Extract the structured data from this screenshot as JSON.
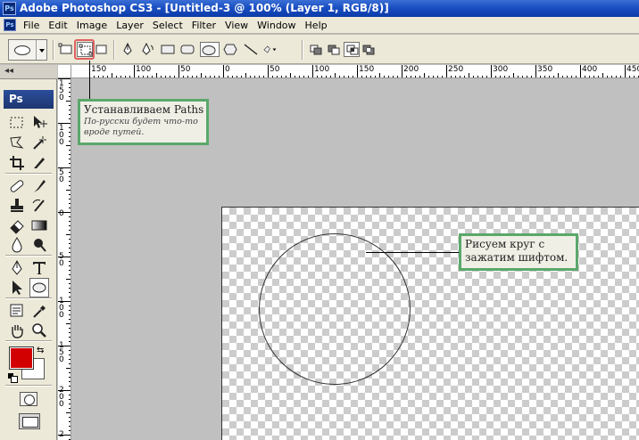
{
  "window": {
    "title": "Adobe Photoshop CS3 - [Untitled-3 @ 100% (Layer 1, RGB/8)]",
    "app_badge": "Ps"
  },
  "menu": {
    "items": [
      "File",
      "Edit",
      "Image",
      "Layer",
      "Select",
      "Filter",
      "View",
      "Window",
      "Help"
    ]
  },
  "options_bar": {
    "tool_preset": "ellipse-icon",
    "mode_buttons": [
      "shape-layers-icon",
      "paths-icon",
      "fill-pixels-icon"
    ],
    "selected_mode": "paths-icon",
    "shape_buttons": [
      "pen-icon",
      "freeform-pen-icon",
      "rectangle-icon",
      "rounded-rectangle-icon",
      "ellipse-icon",
      "polygon-icon",
      "line-icon",
      "custom-shape-icon"
    ],
    "selected_shape": "ellipse-icon",
    "path_ops": [
      "add-to-path-icon",
      "subtract-from-path-icon",
      "intersect-path-icon",
      "exclude-path-icon"
    ]
  },
  "toolbox": {
    "logo": "Ps",
    "dock_label": "◂◂",
    "active_tool": "ellipse-tool",
    "foreground_color": "#d20000",
    "background_color": "#ffffff"
  },
  "rulers": {
    "h_labels": [
      "150",
      "100",
      "50",
      "0",
      "50",
      "100",
      "150",
      "200",
      "250",
      "300",
      "350",
      "400",
      "450"
    ],
    "v_labels": [
      "1 5 0",
      "1 0 0",
      "5 0",
      "0",
      "5 0",
      "1 0 0",
      "1 5 0",
      "2 0 0",
      "2"
    ]
  },
  "annotations": {
    "paths_title": "Устанавливаем Paths",
    "paths_note": "По-русски будет что-то вроде путей.",
    "circle_note": "Рисуем круг с зажатим шифтом."
  },
  "colors": {
    "titlebar": "#1a4fc2",
    "callout_border": "#5aa86a",
    "highlight": "#e06060"
  }
}
